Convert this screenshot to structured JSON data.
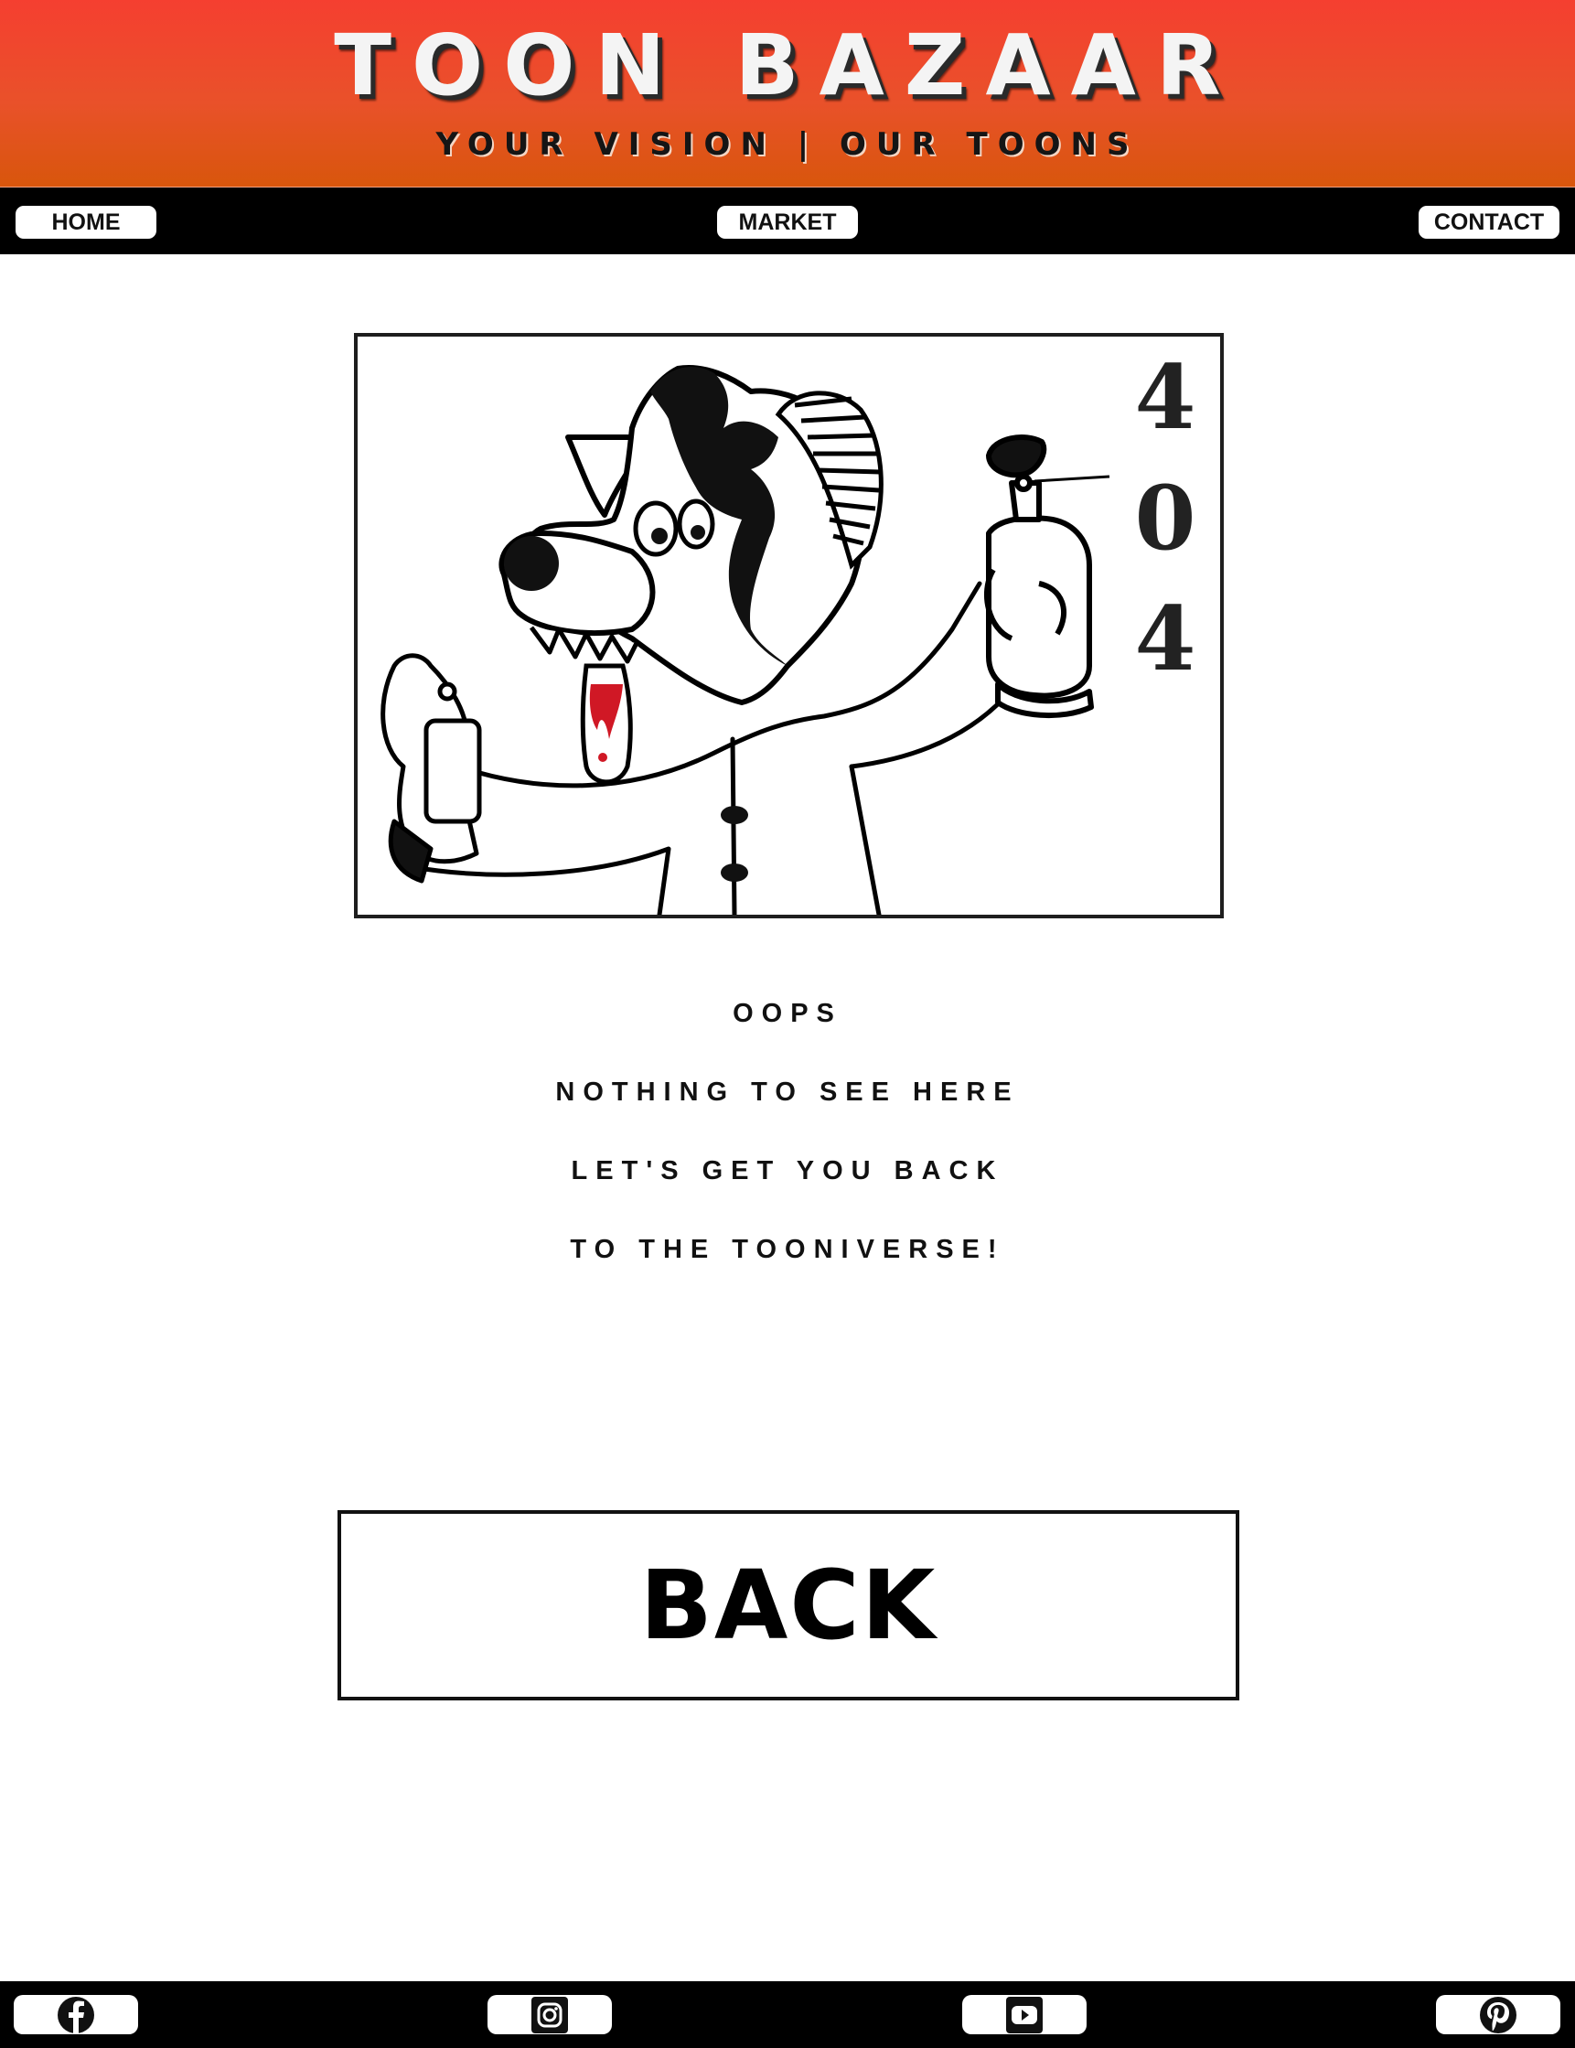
{
  "header": {
    "title": "TOON BAZAAR",
    "tagline": "YOUR VISION | OUR TOONS"
  },
  "nav": {
    "items": [
      {
        "label": "HOME"
      },
      {
        "label": "MARKET"
      },
      {
        "label": "CONTACT"
      }
    ]
  },
  "error_image": {
    "digits": [
      "4",
      "0",
      "4"
    ]
  },
  "message": {
    "lines": [
      "OOPS",
      "NOTHING TO SEE HERE",
      "LET'S GET YOU BACK",
      "TO THE TOONIVERSE!"
    ]
  },
  "back_button": {
    "label": "BACK"
  },
  "footer": {
    "social_icons": [
      "facebook-icon",
      "instagram-icon",
      "youtube-icon",
      "pinterest-icon"
    ]
  },
  "colors": {
    "header_top": "#f53f30",
    "header_bottom": "#d8560c",
    "bar": "#000000",
    "tongue": "#d01825"
  }
}
